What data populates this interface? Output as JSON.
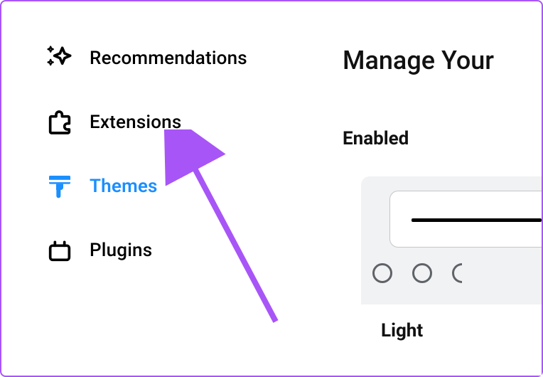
{
  "sidebar": {
    "items": [
      {
        "label": "Recommendations",
        "icon": "sparkles-icon",
        "active": false
      },
      {
        "label": "Extensions",
        "icon": "puzzle-icon",
        "active": false
      },
      {
        "label": "Themes",
        "icon": "brush-icon",
        "active": true
      },
      {
        "label": "Plugins",
        "icon": "plug-icon",
        "active": false
      }
    ]
  },
  "main": {
    "page_title": "Manage Your",
    "section_title": "Enabled",
    "theme_card": {
      "label": "Light"
    }
  },
  "colors": {
    "accent": "#1a8fff",
    "border": "#a855f7",
    "card_bg": "#f1f2f3",
    "circle_stroke": "#5f6368"
  }
}
